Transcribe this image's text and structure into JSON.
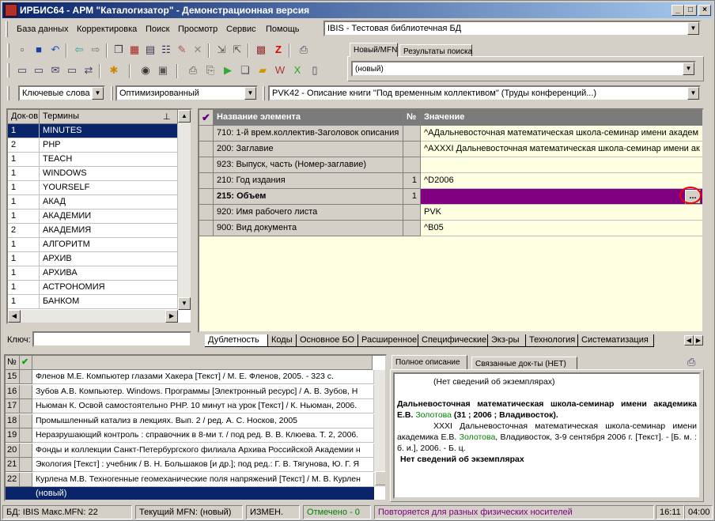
{
  "app": {
    "title": "ИРБИС64 - АРМ \"Каталогизатор\" - Демонстрационная версия"
  },
  "menu": [
    "База данных",
    "Корректировка",
    "Поиск",
    "Просмотр",
    "Сервис",
    "Помощь"
  ],
  "db_select": "IBIS - Тестовая библиотечная БД",
  "tabs_top": [
    "Новый/MFN",
    "Результаты поиска"
  ],
  "mfn_select": "(новый)",
  "search_mode": "Ключевые слова",
  "format_mode": "Оптимизированный",
  "worksheet_select": "PVK42 - Описание книги \"Под временным коллективом\" (Труды конференций...)",
  "terms": {
    "headers": [
      "Док-ов",
      "Термины"
    ],
    "rows": [
      {
        "n": "1",
        "t": "MINUTES"
      },
      {
        "n": "2",
        "t": "PHP"
      },
      {
        "n": "1",
        "t": "TEACH"
      },
      {
        "n": "1",
        "t": "WINDOWS"
      },
      {
        "n": "1",
        "t": "YOURSELF"
      },
      {
        "n": "1",
        "t": "АКАД"
      },
      {
        "n": "1",
        "t": "АКАДЕМИИ"
      },
      {
        "n": "2",
        "t": "АКАДЕМИЯ"
      },
      {
        "n": "1",
        "t": "АЛГОРИТМ"
      },
      {
        "n": "1",
        "t": "АРХИВ"
      },
      {
        "n": "1",
        "t": "АРХИВА"
      },
      {
        "n": "1",
        "t": "АСТРОНОМИЯ"
      },
      {
        "n": "1",
        "t": "БАНКОМ"
      }
    ],
    "key_label": "Ключ:"
  },
  "editor": {
    "headers": [
      "Название элемента",
      "№",
      "Значение"
    ],
    "rows": [
      {
        "name": "710: 1-й врем.коллектив-Заголовок описания",
        "num": "",
        "val": "^AДальневосточная математическая школа-семинар имени академ"
      },
      {
        "name": "200: Заглавие",
        "num": "",
        "val": "^AXXXI Дальневосточная математическая школа-семинар имени ак"
      },
      {
        "name": "923: Выпуск, часть (Номер-заглавие)",
        "num": "",
        "val": ""
      },
      {
        "name": "210: Год издания",
        "num": "1",
        "val": "^D2006"
      },
      {
        "name": "215: Объем",
        "num": "1",
        "val": ""
      },
      {
        "name": "920: Имя рабочего листа",
        "num": "",
        "val": "PVK"
      },
      {
        "name": "900: Вид документа",
        "num": "",
        "val": "^B05"
      }
    ],
    "ellipsis": "...",
    "tabs": [
      "Дублетность",
      "Коды",
      "Основное БО",
      "Расширенное",
      "Специфические",
      "Экз-ры",
      "Технология",
      "Систематизация"
    ]
  },
  "results": {
    "header_no": "№",
    "rows": [
      {
        "n": "15",
        "t": "Фленов М.Е. Компьютер глазами Хакера [Текст] / М. Е. Фленов, 2005. - 323 с."
      },
      {
        "n": "16",
        "t": "Зубов А.В. Компьютер. Windows. Программы [Электронный ресурс] / А. В. Зубов, Н"
      },
      {
        "n": "17",
        "t": "Ньюман К. Освой самостоятельно PHP. 10 минут на урок [Текст] / К. Ньюман, 2006."
      },
      {
        "n": "18",
        "t": "Промышленный катализ в лекциях. Вып. 2 / ред. А. С. Носков, 2005"
      },
      {
        "n": "19",
        "t": "Неразрушающий контроль : справочник в 8-ми т. / под ред. В. В. Клюева. Т. 2, 2006."
      },
      {
        "n": "20",
        "t": "Фонды и коллекции Санкт-Петербургского филиала Архива Российской Академии н"
      },
      {
        "n": "21",
        "t": "Экология [Текст] : учебник / В. Н. Большаков [и др.]; под ред.: Г. В. Тягунова, Ю. Г. Я"
      },
      {
        "n": "22",
        "t": "Курлена М.В. Техногенные геомеханические поля напряжений [Текст] / М. В. Курлен"
      }
    ],
    "new_row": "(новый)"
  },
  "desc": {
    "tabs": [
      "Полное описание",
      "Связанные док-ты (НЕТ)"
    ],
    "line1": "(Нет сведений об экземплярах)",
    "bold_a": "Дальневосточная математическая школа-семинар имени академика Е.В. ",
    "green_a": "Золотова",
    "bold_b": " (31 ; 2006 ; Владивосток).",
    "p2_a": "XXXI Дальневосточная математическая школа-семинар имени академика Е.В. ",
    "green_b": "Золотова",
    "p2_b": ", Владивосток, 3-9 сентября 2006 г. [Текст]. - [Б. м. : б. и.], 2006. - Б. ц.",
    "line_last": "Нет сведений об экземплярах"
  },
  "status": {
    "db": "БД: IBIS Макс.MFN: 22",
    "mfn": "Текущий MFN: (новый)",
    "changed": "ИЗМЕН.",
    "marked": "Отмечено - 0",
    "repeat": "Повторяется для разных физических носителей",
    "time1": "16:11",
    "time2": "04:00"
  },
  "colors": {
    "title_start": "#0a246a",
    "selection": "#0a246a",
    "active_value": "#800080",
    "editor_bg": "#ffffe1",
    "green_text": "#008000",
    "status_green": "#008000",
    "status_purple": "#800080",
    "annotation": "#e00000"
  }
}
